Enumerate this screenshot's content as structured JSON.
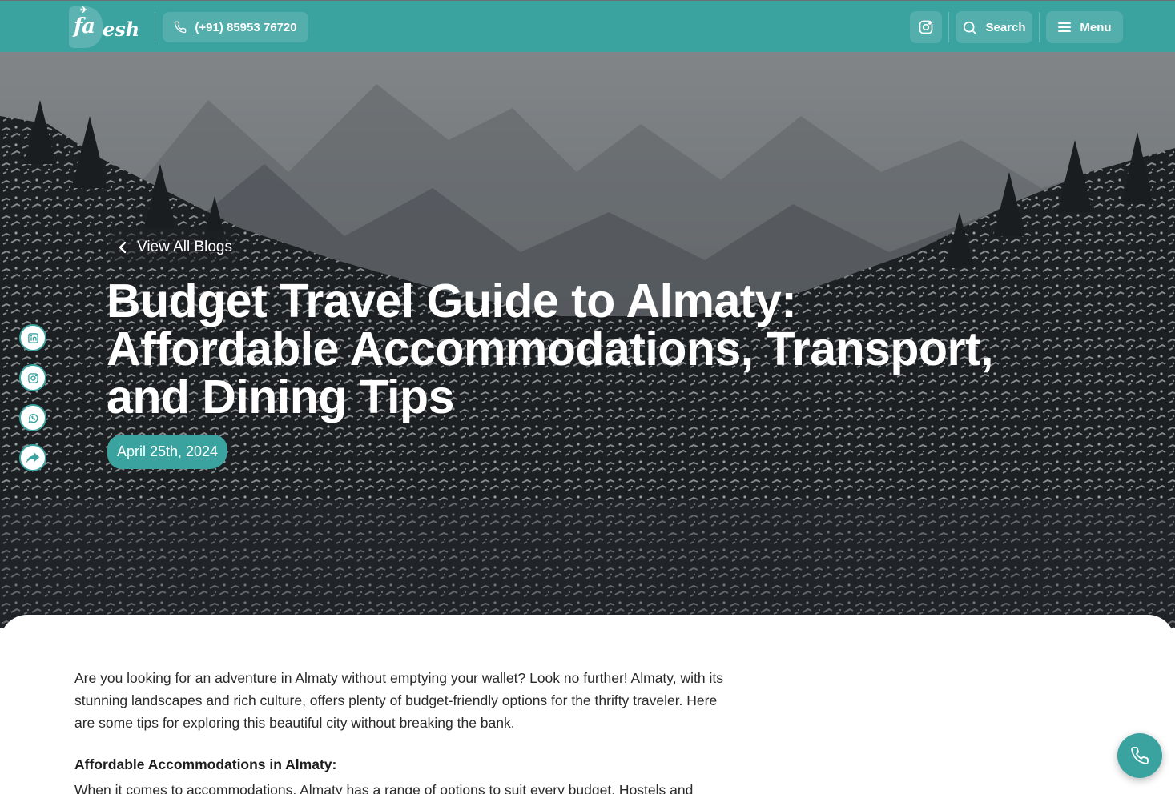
{
  "header": {
    "logo_text": "esh",
    "logo_mark_text": "fa",
    "phone_label": "(+91) 85953 76720",
    "search_label": "Search",
    "menu_label": "Menu",
    "icons": [
      "phone-icon",
      "instagram-icon",
      "search-icon",
      "hamburger-icon"
    ]
  },
  "hero": {
    "back_label": "View All Blogs",
    "title_lines": [
      "Budget Travel Guide to Almaty:",
      "Affordable Accommodations, Transport,",
      "and Dining Tips"
    ],
    "date": "April 25th, 2024"
  },
  "social_share": {
    "icons": [
      "linkedin-icon",
      "instagram-icon",
      "whatsapp-icon",
      "share-icon"
    ]
  },
  "article": {
    "intro": "Are you looking for an adventure in Almaty without emptying your wallet? Look no further! Almaty, with its stunning landscapes and rich culture, offers plenty of budget-friendly options for the thrifty traveler. Here are some tips for exploring this beautiful city without breaking the bank.",
    "section_heading": "Affordable Accommodations in Almaty:",
    "section_text": "When it comes to accommodations, Almaty has a range of options to suit every budget. Hostels and"
  },
  "colors": {
    "brand_teal": "#3aa3a0",
    "text_dark": "#2a2a2a"
  }
}
